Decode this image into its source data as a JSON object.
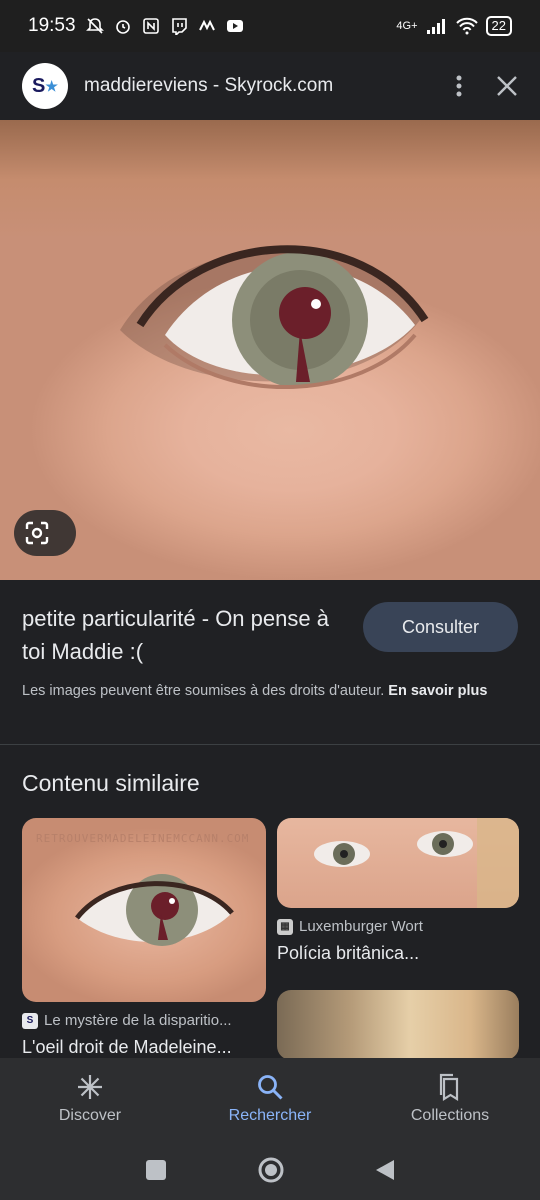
{
  "status_bar": {
    "time": "19:53",
    "network": "4G+",
    "battery": "22"
  },
  "header": {
    "site_logo_text": "S",
    "title": "maddiereviens - Skyrock.com"
  },
  "info": {
    "title": "petite particularité - On pense à toi Maddie :(",
    "consult_button": "Consulter",
    "copyright_text": "Les images peuvent être soumises à des droits d'auteur.",
    "learn_more": "En savoir plus"
  },
  "similar": {
    "heading": "Contenu similaire",
    "items": [
      {
        "watermark": "RETROUVERMADELEINEMCCANN.COM",
        "source": "Le mystère de la disparitio...",
        "title": "L'oeil droit de Madeleine..."
      },
      {
        "source": "Luxemburger Wort",
        "title": "Polícia britânica..."
      }
    ]
  },
  "bottom_nav": {
    "items": [
      {
        "label": "Discover",
        "icon": "asterisk-icon",
        "active": false
      },
      {
        "label": "Rechercher",
        "icon": "search-icon",
        "active": true
      },
      {
        "label": "Collections",
        "icon": "bookmarks-icon",
        "active": false
      }
    ]
  },
  "colors": {
    "background": "#202124",
    "accent": "#8ab4f8",
    "consult_button": "#394457"
  }
}
